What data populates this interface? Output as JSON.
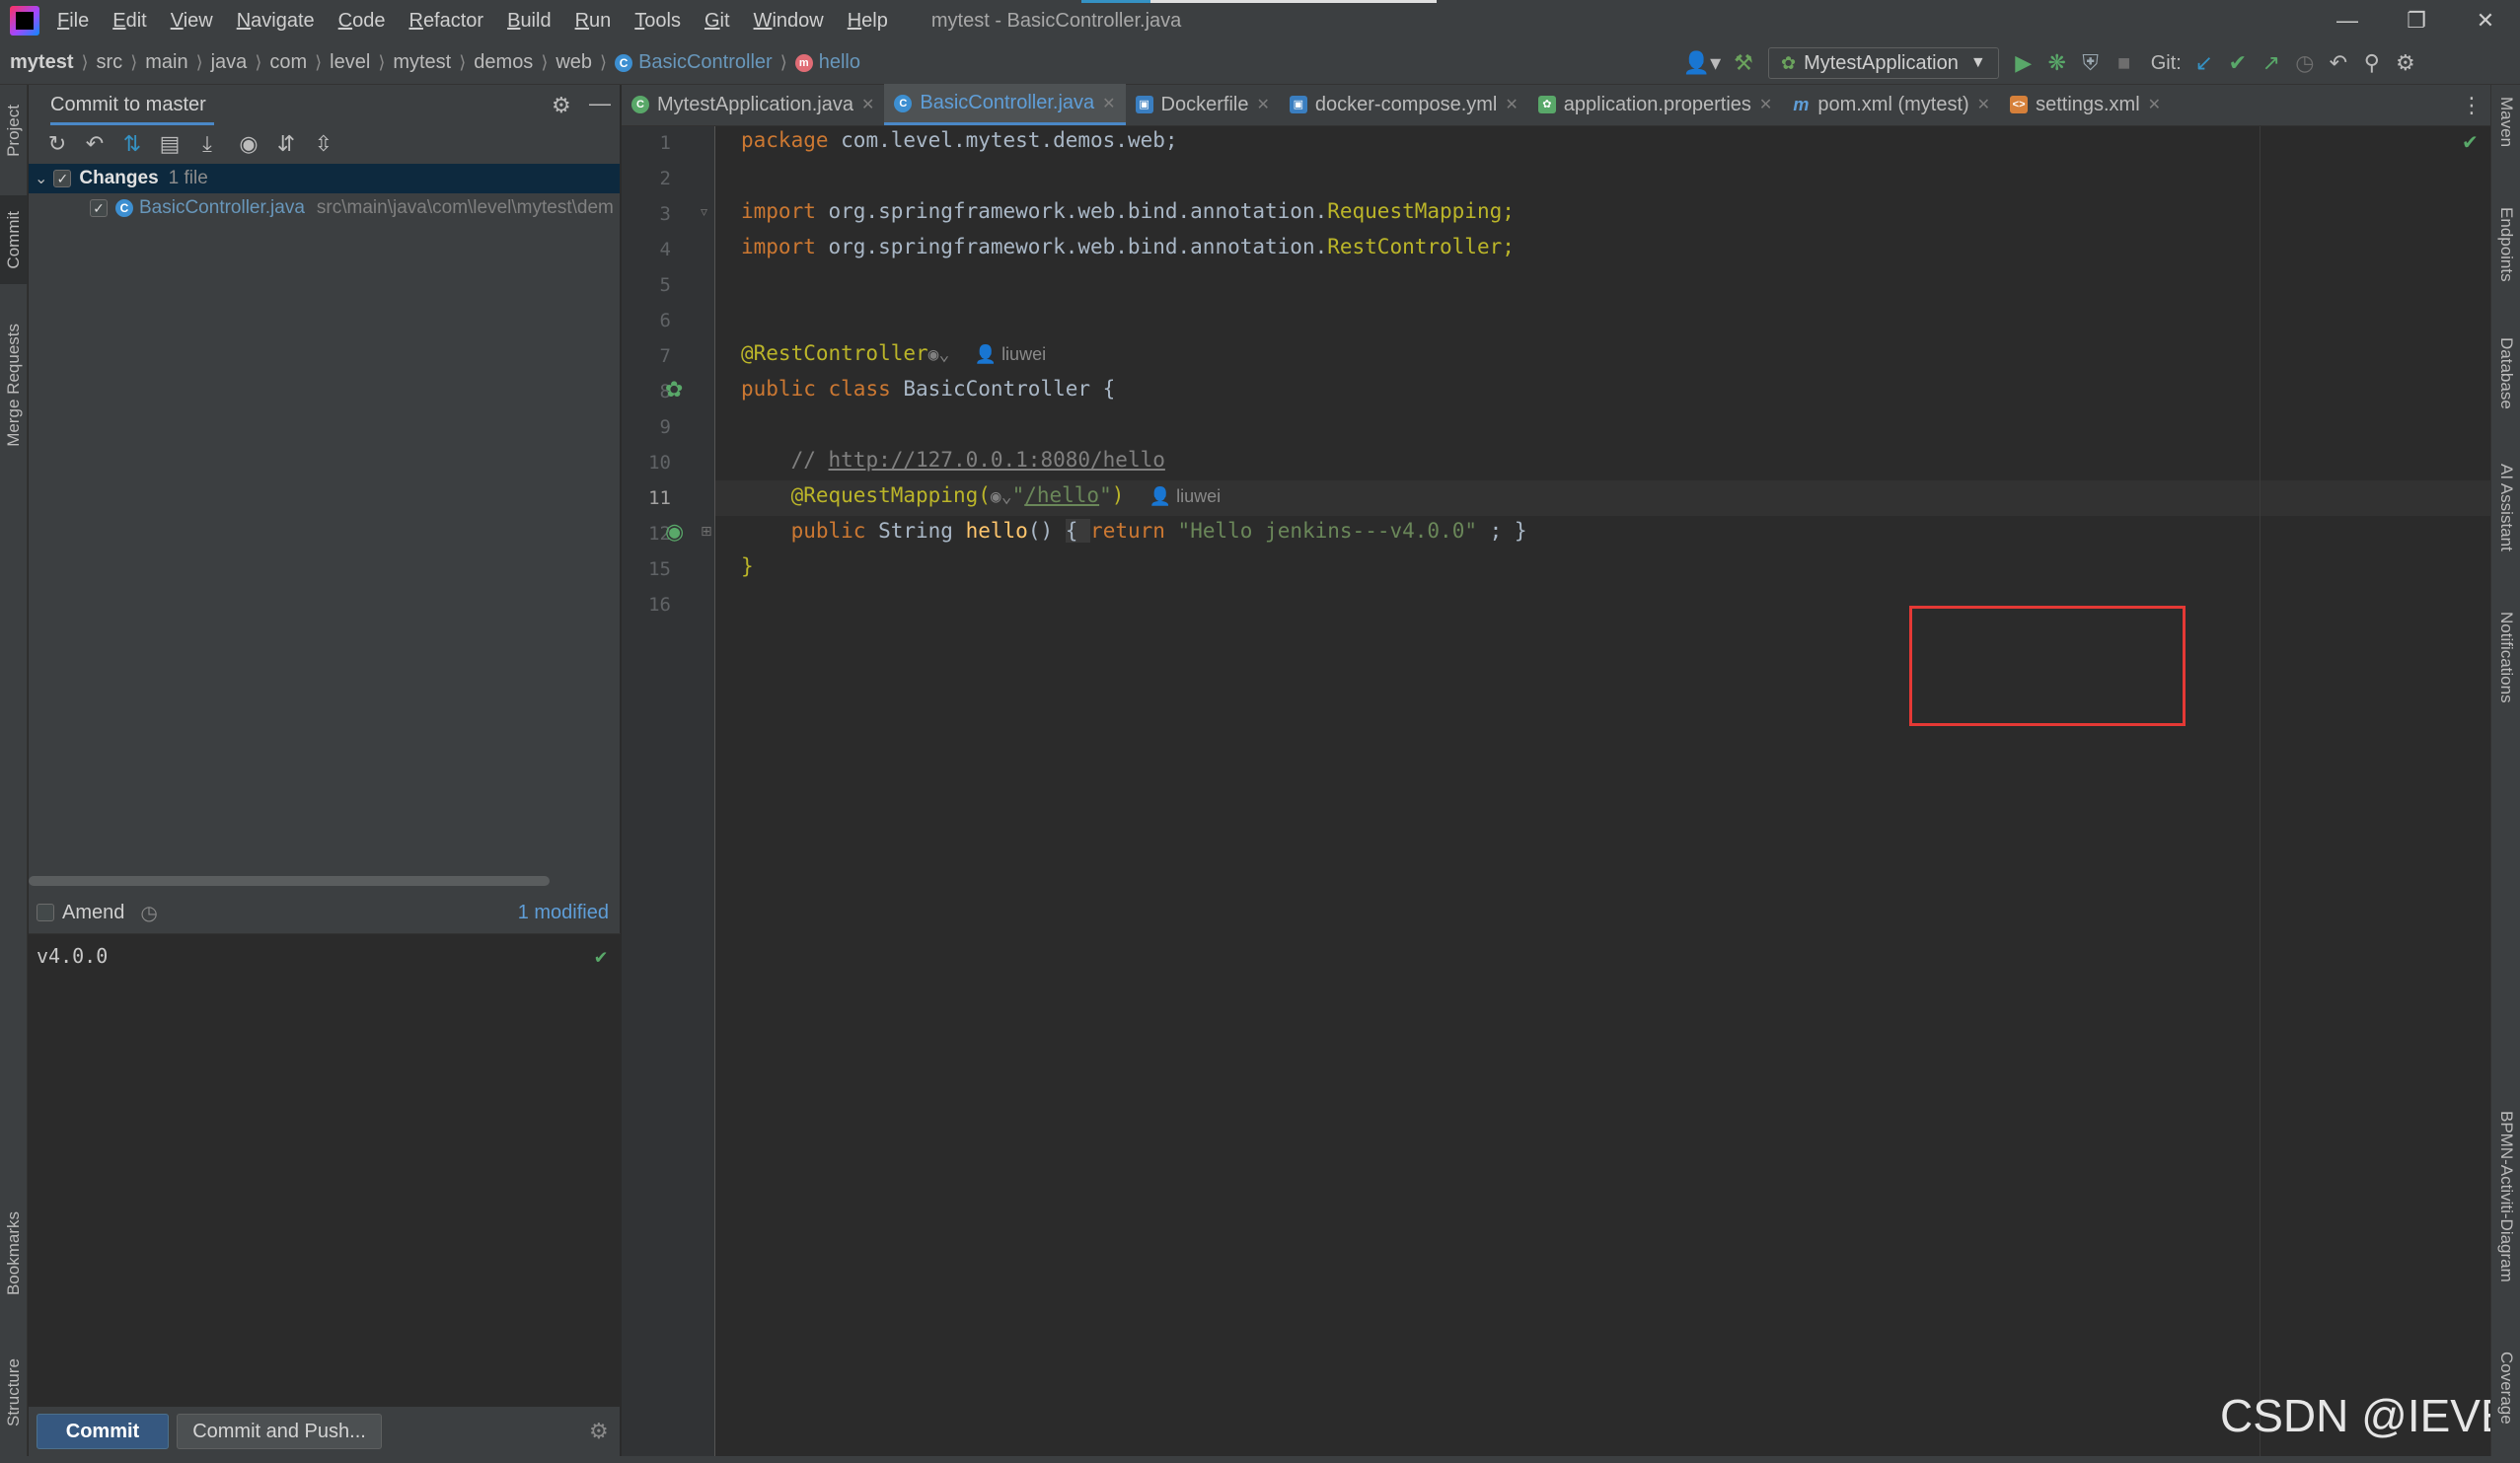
{
  "window": {
    "title": "mytest - BasicController.java",
    "menu": [
      "File",
      "Edit",
      "View",
      "Navigate",
      "Code",
      "Refactor",
      "Build",
      "Run",
      "Tools",
      "Git",
      "Window",
      "Help"
    ]
  },
  "breadcrumbs": [
    "mytest",
    "src",
    "main",
    "java",
    "com",
    "level",
    "mytest",
    "demos",
    "web",
    "BasicController",
    "hello"
  ],
  "run_config": "MytestApplication",
  "git_label": "Git:",
  "left_tool_windows": [
    "Project",
    "Commit",
    "Merge Requests",
    "Bookmarks",
    "Structure"
  ],
  "right_tool_windows": [
    "Maven",
    "Endpoints",
    "Database",
    "AI Assistant",
    "Notifications",
    "BPMN-Activiti-Diagram",
    "Coverage"
  ],
  "commit_panel": {
    "title": "Commit to master",
    "changes_label": "Changes",
    "changes_count": "1 file",
    "file_name": "BasicController.java",
    "file_path": "src\\main\\java\\com\\level\\mytest\\demos",
    "amend_label": "Amend",
    "modified_label": "1 modified",
    "message": "v4.0.0",
    "commit_button": "Commit",
    "commit_push_button": "Commit and Push..."
  },
  "tabs": [
    {
      "label": "MytestApplication.java",
      "icon": "spring-class-icon"
    },
    {
      "label": "BasicController.java",
      "icon": "class-icon",
      "active": true
    },
    {
      "label": "Dockerfile",
      "icon": "docker-icon"
    },
    {
      "label": "docker-compose.yml",
      "icon": "docker-compose-icon"
    },
    {
      "label": "application.properties",
      "icon": "properties-icon"
    },
    {
      "label": "pom.xml (mytest)",
      "icon": "maven-icon"
    },
    {
      "label": "settings.xml",
      "icon": "xml-icon"
    }
  ],
  "code": {
    "line_numbers": [
      "1",
      "2",
      "3",
      "4",
      "5",
      "6",
      "7",
      "8",
      "9",
      "10",
      "11",
      "12",
      "15",
      "16"
    ],
    "package_kw": "package",
    "package_name": " com.level.mytest.demos.web;",
    "import_kw": "import",
    "import1_prefix": " org.springframework.web.bind.annotation.",
    "import1_class": "RequestMapping;",
    "import2_prefix": " org.springframework.web.bind.annotation.",
    "import2_class": "RestController;",
    "rest_controller": "@RestController",
    "author": "liuwei",
    "public_kw": "public",
    "class_kw": "class",
    "class_name": " BasicController {",
    "comment_prefix": "// ",
    "comment_url": "http://127.0.0.1:8080/hello",
    "request_mapping": "@RequestMapping(",
    "mapping_value_q1": "\"",
    "mapping_value": "/hello",
    "mapping_value_q2": "\"",
    "mapping_close": ")",
    "method_type": " String ",
    "method_name": "hello",
    "method_parens": "() ",
    "method_open": "{ ",
    "return_kw": "return",
    "return_value": " \"Hello jenkins---v4.0.0\"",
    "return_end": " ; }",
    "closing_brace": "}"
  },
  "watermark": "CSDN @IEVE"
}
